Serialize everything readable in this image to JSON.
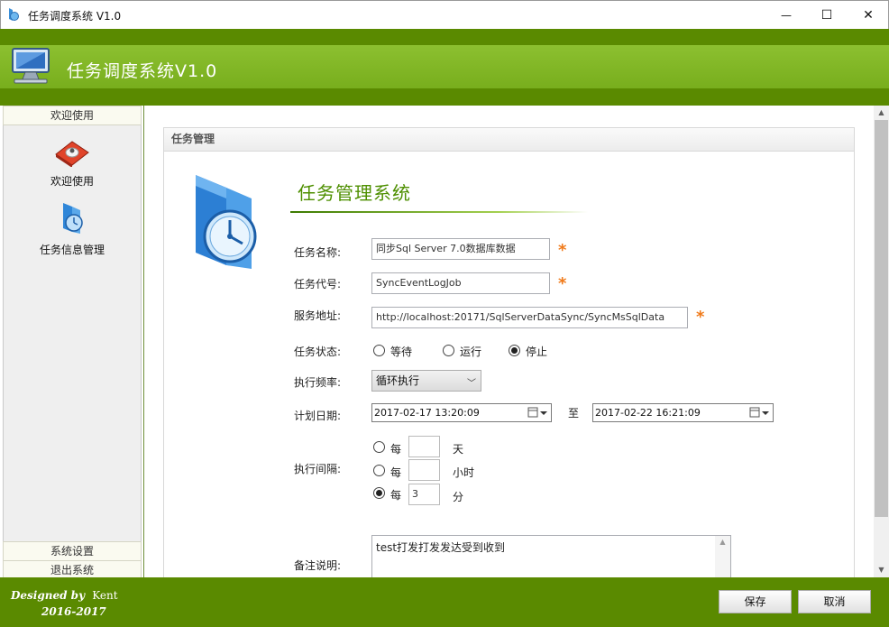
{
  "window": {
    "title": "任务调度系统 V1.0",
    "controls": {
      "minimize": "—",
      "maximize": "☐",
      "close": "✕"
    }
  },
  "header": {
    "app_title": "任务调度系统V1.0"
  },
  "sidebar": {
    "top_section": "欢迎使用",
    "items": [
      {
        "label": "欢迎使用",
        "icon": "welcome-icon"
      },
      {
        "label": "任务信息管理",
        "icon": "task-info-icon"
      }
    ],
    "bottom_sections": [
      "系统设置",
      "退出系统"
    ]
  },
  "panel": {
    "header": "任务管理",
    "title": "任务管理系统",
    "form": {
      "name_label": "任务名称:",
      "name_value": "同步Sql  Server  7.0数据库数据",
      "code_label": "任务代号:",
      "code_value": "SyncEventLogJob",
      "url_label": "服务地址:",
      "url_value": "http://localhost:20171/SqlServerDataSync/SyncMsSqlData",
      "required_mark": "*",
      "status_label": "任务状态:",
      "status_options": [
        "等待",
        "运行",
        "停止"
      ],
      "status_selected": "停止",
      "freq_label": "执行频率:",
      "freq_value": "循环执行",
      "date_label": "计划日期:",
      "date_start": "2017-02-17 13:20:09",
      "date_sep": "至",
      "date_end": "2017-02-22  16:21:09",
      "interval_label": "执行间隔:",
      "interval_rows": [
        {
          "prefix": "每",
          "value": "",
          "unit": "天",
          "selected": false
        },
        {
          "prefix": "每",
          "value": "",
          "unit": "小时",
          "selected": false
        },
        {
          "prefix": "每",
          "value": "3",
          "unit": "分",
          "selected": true
        }
      ],
      "remark_label": "备注说明:",
      "remark_value": "test打发打发发达受到收到"
    }
  },
  "footer": {
    "credit": "Designed by",
    "author": "Kent",
    "years": "2016-2017",
    "save_label": "保存",
    "cancel_label": "取消"
  },
  "colors": {
    "header_green": "#5a8a00",
    "band_green": "#80b426",
    "title_green": "#4e8f00",
    "required_orange": "#f07a1a"
  }
}
